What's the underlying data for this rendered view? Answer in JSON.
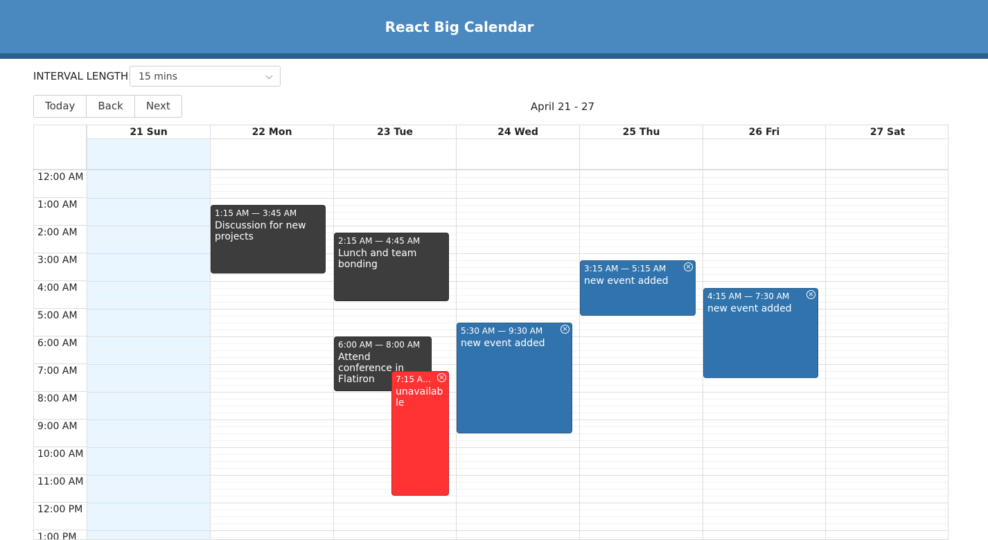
{
  "header": {
    "title": "React Big Calendar"
  },
  "interval": {
    "label": "INTERVAL LENGTH:",
    "value": "15 mins"
  },
  "toolbar": {
    "today": "Today",
    "back": "Back",
    "next": "Next",
    "range": "April 21 - 27"
  },
  "days": [
    "21 Sun",
    "22 Mon",
    "23 Tue",
    "24 Wed",
    "25 Thu",
    "26 Fri",
    "27 Sat"
  ],
  "times": [
    "12:00 AM",
    "1:00 AM",
    "2:00 AM",
    "3:00 AM",
    "4:00 AM",
    "5:00 AM",
    "6:00 AM",
    "7:00 AM",
    "8:00 AM",
    "9:00 AM",
    "10:00 AM",
    "11:00 AM",
    "12:00 PM",
    "1:00 PM"
  ],
  "events": [
    {
      "time": "1:15 AM — 3:45 AM",
      "title": "Discussion for new projects",
      "style": "dark",
      "closable": false
    },
    {
      "time": "2:15 AM — 4:45 AM",
      "title": "Lunch and team bonding",
      "style": "dark",
      "closable": false
    },
    {
      "time": "6:00 AM — 8:00 AM",
      "title": "Attend conference in Flatiron",
      "style": "dark",
      "closable": false
    },
    {
      "time": "7:15 AM ...",
      "title": "unavailable",
      "style": "red",
      "closable": true
    },
    {
      "time": "5:30 AM — 9:30 AM",
      "title": "new event added",
      "style": "blue",
      "closable": true
    },
    {
      "time": "3:15 AM — 5:15 AM",
      "title": "new event added",
      "style": "blue",
      "closable": true
    },
    {
      "time": "4:15 AM — 7:30 AM",
      "title": "new event added",
      "style": "blue",
      "closable": true
    }
  ],
  "close_glyph": "×",
  "colors": {
    "header": "#4a89bf",
    "event_dark": "#3d3d3d",
    "event_blue": "#3174ad",
    "event_red": "#ff3333",
    "today": "#eaf6ff"
  }
}
